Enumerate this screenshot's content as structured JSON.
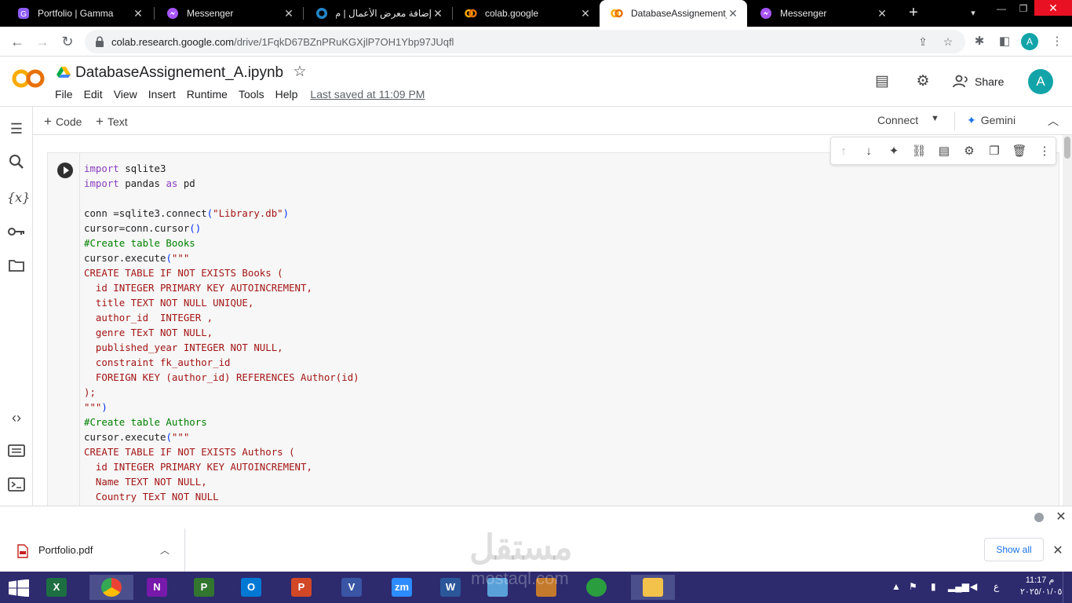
{
  "browser": {
    "tabs": [
      {
        "title": "Portfolio | Gamma",
        "icon": "gamma-icon"
      },
      {
        "title": "Messenger",
        "icon": "messenger-icon"
      },
      {
        "title": "إضافة معرض الأعمال | م",
        "icon": "mostaql-icon"
      },
      {
        "title": "colab.google",
        "icon": "colab-icon"
      },
      {
        "title": "DatabaseAssignement_",
        "icon": "colab-icon",
        "active": true
      },
      {
        "title": "Messenger",
        "icon": "messenger-icon"
      }
    ],
    "url_host": "colab.research.google.com",
    "url_path": "/drive/1FqkD67BZnPRuKGXjlP7OH1Ybp97JUqfl",
    "profile_initial": "A"
  },
  "colab": {
    "notebook_title": "DatabaseAssignement_A.ipynb",
    "menu": [
      "File",
      "Edit",
      "View",
      "Insert",
      "Runtime",
      "Tools",
      "Help"
    ],
    "last_saved": "Last saved at 11:09 PM",
    "share_label": "Share",
    "avatar_initial": "A",
    "add_code": "Code",
    "add_text": "Text",
    "connect_label": "Connect",
    "gemini_label": "Gemini"
  },
  "code_lines": [
    [
      [
        "kw",
        "import"
      ],
      [
        "op",
        " sqlite3"
      ]
    ],
    [
      [
        "kw",
        "import"
      ],
      [
        "op",
        " pandas "
      ],
      [
        "kw",
        "as"
      ],
      [
        "op",
        " pd"
      ]
    ],
    [],
    [
      [
        "op",
        "conn =sqlite3.connect"
      ],
      [
        "paren",
        "("
      ],
      [
        "str",
        "\"Library.db\""
      ],
      [
        "paren",
        ")"
      ]
    ],
    [
      [
        "op",
        "cursor=conn.cursor"
      ],
      [
        "paren",
        "()"
      ]
    ],
    [
      [
        "cmt",
        "#Create table Books"
      ]
    ],
    [
      [
        "op",
        "cursor.execute"
      ],
      [
        "paren",
        "("
      ],
      [
        "str",
        "\"\"\""
      ]
    ],
    [
      [
        "str",
        "CREATE TABLE IF NOT EXISTS Books ("
      ]
    ],
    [
      [
        "str",
        "  id INTEGER PRIMARY KEY AUTOINCREMENT,"
      ]
    ],
    [
      [
        "str",
        "  title TEXT NOT NULL UNIQUE,"
      ]
    ],
    [
      [
        "str",
        "  author_id  INTEGER ,"
      ]
    ],
    [
      [
        "str",
        "  genre TExT NOT NULL,"
      ]
    ],
    [
      [
        "str",
        "  published_year INTEGER NOT NULL,"
      ]
    ],
    [
      [
        "str",
        "  constraint fk_author_id"
      ]
    ],
    [
      [
        "str",
        "  FOREIGN KEY (author_id) REFERENCES Author(id)"
      ]
    ],
    [
      [
        "str",
        ");"
      ]
    ],
    [
      [
        "str",
        "\"\"\""
      ],
      [
        "paren",
        ")"
      ]
    ],
    [
      [
        "cmt",
        "#Create table Authors"
      ]
    ],
    [
      [
        "op",
        "cursor.execute"
      ],
      [
        "paren",
        "("
      ],
      [
        "str",
        "\"\"\""
      ]
    ],
    [
      [
        "str",
        "CREATE TABLE IF NOT EXISTS Authors ("
      ]
    ],
    [
      [
        "str",
        "  id INTEGER PRIMARY KEY AUTOINCREMENT,"
      ]
    ],
    [
      [
        "str",
        "  Name TEXT NOT NULL,"
      ]
    ],
    [
      [
        "str",
        "  Country TExT NOT NULL"
      ]
    ]
  ],
  "downloads": {
    "file_name": "Portfolio.pdf",
    "show_all": "Show all"
  },
  "watermark": {
    "arabic": "مستقل",
    "latin": "mostaql.com"
  },
  "taskbar": {
    "apps": [
      {
        "name": "excel",
        "letter": "X",
        "color": "#1d6f42"
      },
      {
        "name": "chrome",
        "letter": "",
        "color": "#4285f4",
        "active": true
      },
      {
        "name": "onenote",
        "letter": "N",
        "color": "#7719aa"
      },
      {
        "name": "project",
        "letter": "P",
        "color": "#31752f"
      },
      {
        "name": "outlook",
        "letter": "O",
        "color": "#0078d4"
      },
      {
        "name": "powerpoint",
        "letter": "P",
        "color": "#d24726"
      },
      {
        "name": "visio",
        "letter": "V",
        "color": "#3955a3"
      },
      {
        "name": "zoom",
        "letter": "zm",
        "color": "#2d8cff"
      },
      {
        "name": "word",
        "letter": "W",
        "color": "#2b579a"
      },
      {
        "name": "notepad",
        "letter": "",
        "color": "#5aa0d8"
      },
      {
        "name": "character",
        "letter": "",
        "color": "#c47a2c"
      },
      {
        "name": "spinner",
        "letter": "",
        "color": "#2a9d3f"
      },
      {
        "name": "file-explorer",
        "letter": "",
        "color": "#f3c24b",
        "active": true
      }
    ],
    "lang": "ع",
    "time": "11:17 م",
    "date": "٢٠٢٥/٠١/٠٥"
  }
}
